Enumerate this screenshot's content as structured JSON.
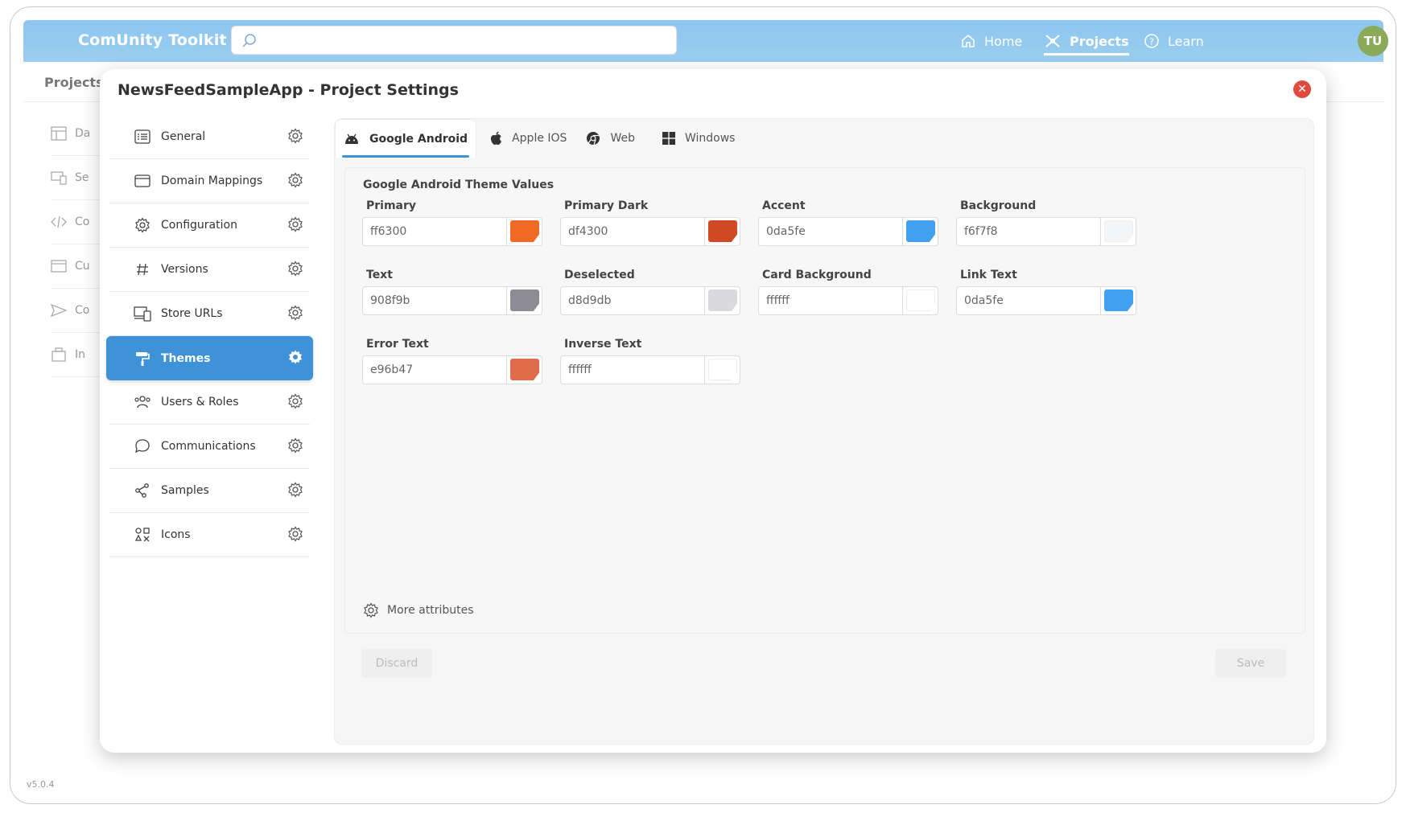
{
  "app": {
    "brand": "ComUnity Toolkit",
    "version": "v5.0.4",
    "nav": [
      {
        "label": "Home",
        "icon": "home-icon",
        "active": false
      },
      {
        "label": "Projects",
        "icon": "projects-icon",
        "active": true
      },
      {
        "label": "Learn",
        "icon": "help-icon",
        "active": false
      }
    ],
    "avatar": "TU",
    "search": {
      "placeholder": "",
      "value": ""
    }
  },
  "background": {
    "subheader": "Projects",
    "side_items": [
      "Da",
      "Se",
      "Co",
      "Cu",
      "Co",
      "In"
    ]
  },
  "modal": {
    "title": "NewsFeedSampleApp - Project Settings",
    "menu": [
      {
        "label": "General",
        "icon": "list-icon"
      },
      {
        "label": "Domain Mappings",
        "icon": "window-icon"
      },
      {
        "label": "Configuration",
        "icon": "cog-icon"
      },
      {
        "label": "Versions",
        "icon": "hash-icon"
      },
      {
        "label": "Store URLs",
        "icon": "devices-icon"
      },
      {
        "label": "Themes",
        "icon": "paint-roller-icon",
        "active": true
      },
      {
        "label": "Users & Roles",
        "icon": "users-icon"
      },
      {
        "label": "Communications",
        "icon": "chat-bubble-icon"
      },
      {
        "label": "Samples",
        "icon": "share-nodes-icon"
      },
      {
        "label": "Icons",
        "icon": "icons-grid-icon"
      }
    ],
    "tabs": [
      {
        "label": "Google Android",
        "icon": "android-icon",
        "active": true
      },
      {
        "label": "Apple IOS",
        "icon": "apple-icon"
      },
      {
        "label": "Web",
        "icon": "chrome-icon"
      },
      {
        "label": "Windows",
        "icon": "windows-icon"
      }
    ],
    "panel_title": "Google Android Theme Values",
    "fields": [
      {
        "label": "Primary",
        "value": "ff6300",
        "color": "#f06a26"
      },
      {
        "label": "Primary Dark",
        "value": "df4300",
        "color": "#cf4a22"
      },
      {
        "label": "Accent",
        "value": "0da5fe",
        "color": "#42a0f0"
      },
      {
        "label": "Background",
        "value": "f6f7f8",
        "color": "#f4f5f6"
      },
      {
        "label": "Text",
        "value": "908f9b",
        "color": "#8d8c95"
      },
      {
        "label": "Deselected",
        "value": "d8d9db",
        "color": "#dadadc"
      },
      {
        "label": "Card Background",
        "value": "ffffff",
        "color": "#ffffff"
      },
      {
        "label": "Link Text",
        "value": "0da5fe",
        "color": "#42a0f0"
      },
      {
        "label": "Error Text",
        "value": "e96b47",
        "color": "#df6b4b"
      },
      {
        "label": "Inverse Text",
        "value": "ffffff",
        "color": "#ffffff"
      }
    ],
    "more_attributes": "More attributes",
    "discard_label": "Discard",
    "save_label": "Save"
  }
}
